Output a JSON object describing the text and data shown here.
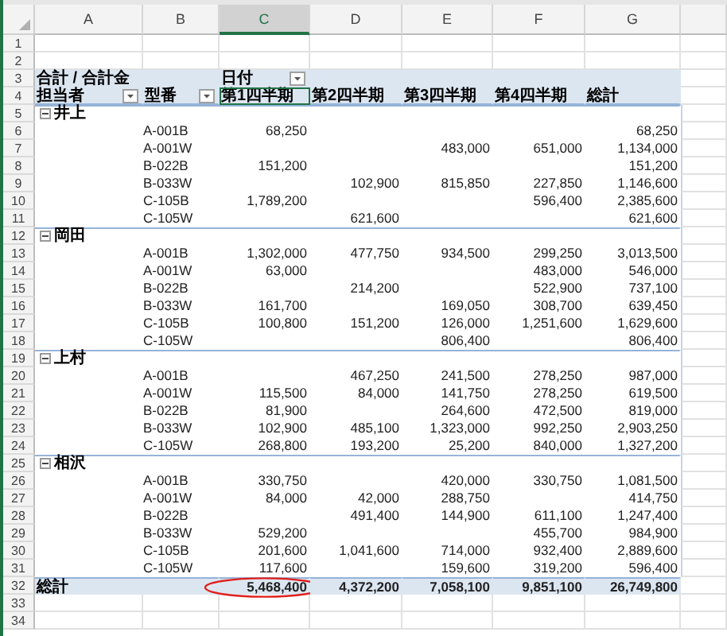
{
  "column_letters": [
    {
      "label": "A",
      "selected": false
    },
    {
      "label": "B",
      "selected": false
    },
    {
      "label": "C",
      "selected": true
    },
    {
      "label": "D",
      "selected": false
    },
    {
      "label": "E",
      "selected": false
    },
    {
      "label": "F",
      "selected": false
    },
    {
      "label": "G",
      "selected": false
    }
  ],
  "row_numbers": [
    "1",
    "2",
    "3",
    "4",
    "5",
    "6",
    "7",
    "8",
    "9",
    "10",
    "11",
    "12",
    "13",
    "14",
    "15",
    "16",
    "17",
    "18",
    "19",
    "20",
    "21",
    "22",
    "23",
    "24",
    "25",
    "26",
    "27",
    "28",
    "29",
    "30",
    "31",
    "32",
    "33",
    "34"
  ],
  "pivot": {
    "value_label": "合計 / 合計金",
    "column_field": "日付",
    "row_fields": [
      "担当者",
      "型番"
    ],
    "columns": [
      {
        "label": "第1四半期",
        "selected": true
      },
      {
        "label": "第2四半期",
        "selected": false
      },
      {
        "label": "第3四半期",
        "selected": false
      },
      {
        "label": "第4四半期",
        "selected": false
      },
      {
        "label": "総計",
        "selected": false
      }
    ],
    "groups": [
      {
        "name": "井上",
        "expanded": true,
        "rows": [
          {
            "model": "A-001B",
            "q1": "68,250",
            "total": "68,250"
          },
          {
            "model": "A-001W",
            "q3": "483,000",
            "q4": "651,000",
            "total": "1,134,000"
          },
          {
            "model": "B-022B",
            "q1": "151,200",
            "total": "151,200"
          },
          {
            "model": "B-033W",
            "q2": "102,900",
            "q3": "815,850",
            "q4": "227,850",
            "total": "1,146,600"
          },
          {
            "model": "C-105B",
            "q1": "1,789,200",
            "q4": "596,400",
            "total": "2,385,600"
          },
          {
            "model": "C-105W",
            "q2": "621,600",
            "total": "621,600"
          }
        ]
      },
      {
        "name": "岡田",
        "expanded": true,
        "rows": [
          {
            "model": "A-001B",
            "q1": "1,302,000",
            "q2": "477,750",
            "q3": "934,500",
            "q4": "299,250",
            "total": "3,013,500"
          },
          {
            "model": "A-001W",
            "q1": "63,000",
            "q4": "483,000",
            "total": "546,000"
          },
          {
            "model": "B-022B",
            "q2": "214,200",
            "q4": "522,900",
            "total": "737,100"
          },
          {
            "model": "B-033W",
            "q1": "161,700",
            "q3": "169,050",
            "q4": "308,700",
            "total": "639,450"
          },
          {
            "model": "C-105B",
            "q1": "100,800",
            "q2": "151,200",
            "q3": "126,000",
            "q4": "1,251,600",
            "total": "1,629,600"
          },
          {
            "model": "C-105W",
            "q3": "806,400",
            "total": "806,400"
          }
        ]
      },
      {
        "name": "上村",
        "expanded": true,
        "rows": [
          {
            "model": "A-001B",
            "q2": "467,250",
            "q3": "241,500",
            "q4": "278,250",
            "total": "987,000"
          },
          {
            "model": "A-001W",
            "q1": "115,500",
            "q2": "84,000",
            "q3": "141,750",
            "q4": "278,250",
            "total": "619,500"
          },
          {
            "model": "B-022B",
            "q1": "81,900",
            "q3": "264,600",
            "q4": "472,500",
            "total": "819,000"
          },
          {
            "model": "B-033W",
            "q1": "102,900",
            "q2": "485,100",
            "q3": "1,323,000",
            "q4": "992,250",
            "total": "2,903,250"
          },
          {
            "model": "C-105W",
            "q1": "268,800",
            "q2": "193,200",
            "q3": "25,200",
            "q4": "840,000",
            "total": "1,327,200"
          }
        ]
      },
      {
        "name": "相沢",
        "expanded": true,
        "rows": [
          {
            "model": "A-001B",
            "q1": "330,750",
            "q3": "420,000",
            "q4": "330,750",
            "total": "1,081,500"
          },
          {
            "model": "A-001W",
            "q1": "84,000",
            "q2": "42,000",
            "q3": "288,750",
            "total": "414,750"
          },
          {
            "model": "B-022B",
            "q2": "491,400",
            "q3": "144,900",
            "q4": "611,100",
            "total": "1,247,400"
          },
          {
            "model": "B-033W",
            "q1": "529,200",
            "q4": "455,700",
            "total": "984,900"
          },
          {
            "model": "C-105B",
            "q1": "201,600",
            "q2": "1,041,600",
            "q3": "714,000",
            "q4": "932,400",
            "total": "2,889,600"
          },
          {
            "model": "C-105W",
            "q1": "117,600",
            "q3": "159,600",
            "q4": "319,200",
            "total": "596,400"
          }
        ]
      }
    ],
    "grand_total": {
      "label": "総計",
      "values": [
        {
          "text": "5,468,400",
          "circled": true
        },
        {
          "text": "4,372,200",
          "circled": false
        },
        {
          "text": "7,058,100",
          "circled": false
        },
        {
          "text": "9,851,100",
          "circled": false
        },
        {
          "text": "26,749,800",
          "circled": false
        }
      ]
    }
  }
}
